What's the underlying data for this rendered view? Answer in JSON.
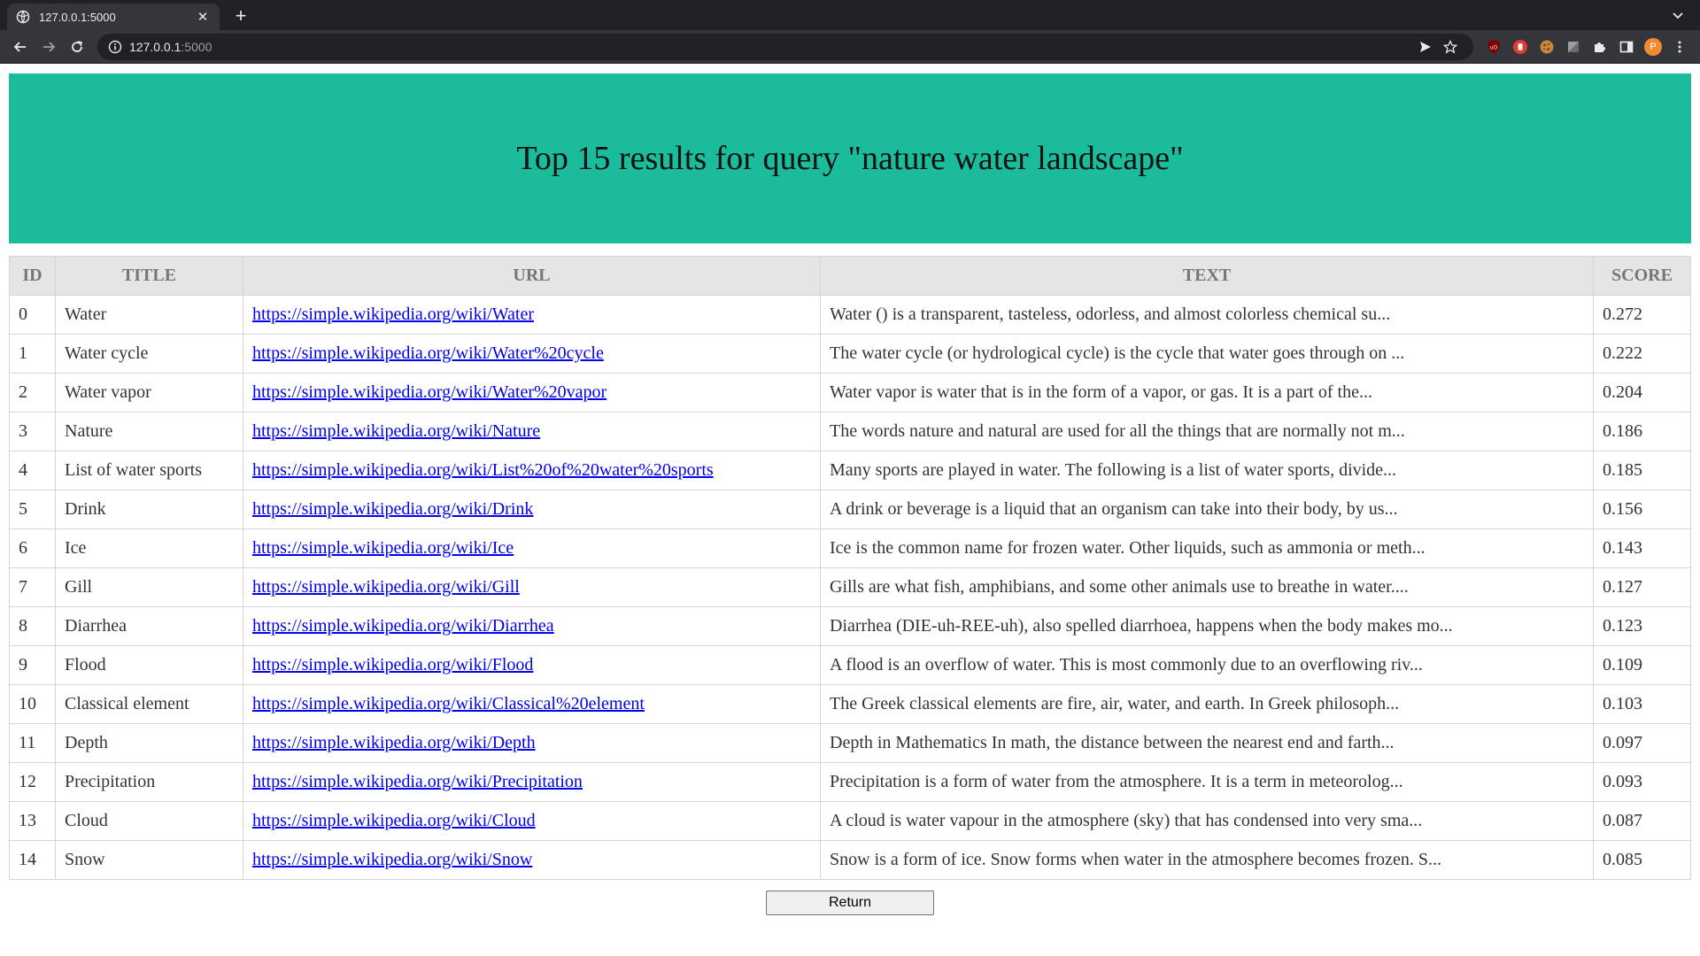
{
  "browser": {
    "tab_title": "127.0.0.1:5000",
    "url_host": "127.0.0.1",
    "url_port": ":5000",
    "profile_initial": "P"
  },
  "page": {
    "heading": "Top 15 results for query \"nature water landscape\"",
    "columns": [
      "ID",
      "TITLE",
      "URL",
      "TEXT",
      "SCORE"
    ],
    "rows": [
      {
        "id": "0",
        "title": "Water",
        "url": "https://simple.wikipedia.org/wiki/Water",
        "text": "Water () is a transparent, tasteless, odorless, and almost colorless chemical su...",
        "score": "0.272"
      },
      {
        "id": "1",
        "title": "Water cycle",
        "url": "https://simple.wikipedia.org/wiki/Water%20cycle",
        "text": "The water cycle (or hydrological cycle) is the cycle that water goes through on ...",
        "score": "0.222"
      },
      {
        "id": "2",
        "title": "Water vapor",
        "url": "https://simple.wikipedia.org/wiki/Water%20vapor",
        "text": "Water vapor is water that is in the form of a vapor, or gas. It is a part of the...",
        "score": "0.204"
      },
      {
        "id": "3",
        "title": "Nature",
        "url": "https://simple.wikipedia.org/wiki/Nature",
        "text": "The words nature and natural are used for all the things that are normally not m...",
        "score": "0.186"
      },
      {
        "id": "4",
        "title": "List of water sports",
        "url": "https://simple.wikipedia.org/wiki/List%20of%20water%20sports",
        "text": "Many sports are played in water. The following is a list of water sports, divide...",
        "score": "0.185"
      },
      {
        "id": "5",
        "title": "Drink",
        "url": "https://simple.wikipedia.org/wiki/Drink",
        "text": "A drink or beverage is a liquid that an organism can take into their body, by us...",
        "score": "0.156"
      },
      {
        "id": "6",
        "title": "Ice",
        "url": "https://simple.wikipedia.org/wiki/Ice",
        "text": "Ice is the common name for frozen water. Other liquids, such as ammonia or meth...",
        "score": "0.143"
      },
      {
        "id": "7",
        "title": "Gill",
        "url": "https://simple.wikipedia.org/wiki/Gill",
        "text": "Gills are what fish, amphibians, and some other animals use to breathe in water....",
        "score": "0.127"
      },
      {
        "id": "8",
        "title": "Diarrhea",
        "url": "https://simple.wikipedia.org/wiki/Diarrhea",
        "text": "Diarrhea (DIE-uh-REE-uh), also spelled diarrhoea, happens when the body makes mo...",
        "score": "0.123"
      },
      {
        "id": "9",
        "title": "Flood",
        "url": "https://simple.wikipedia.org/wiki/Flood",
        "text": "A flood is an overflow of water. This is most commonly due to an overflowing riv...",
        "score": "0.109"
      },
      {
        "id": "10",
        "title": "Classical element",
        "url": "https://simple.wikipedia.org/wiki/Classical%20element",
        "text": "The Greek classical elements are fire, air, water, and earth. In Greek philosoph...",
        "score": "0.103"
      },
      {
        "id": "11",
        "title": "Depth",
        "url": "https://simple.wikipedia.org/wiki/Depth",
        "text": "Depth in Mathematics In math, the distance between the nearest end and farth...",
        "score": "0.097"
      },
      {
        "id": "12",
        "title": "Precipitation",
        "url": "https://simple.wikipedia.org/wiki/Precipitation",
        "text": "Precipitation is a form of water from the atmosphere. It is a term in meteorolog...",
        "score": "0.093"
      },
      {
        "id": "13",
        "title": "Cloud",
        "url": "https://simple.wikipedia.org/wiki/Cloud",
        "text": "A cloud is water vapour in the atmosphere (sky) that has condensed into very sma...",
        "score": "0.087"
      },
      {
        "id": "14",
        "title": "Snow",
        "url": "https://simple.wikipedia.org/wiki/Snow",
        "text": "Snow is a form of ice. Snow forms when water in the atmosphere becomes frozen. S...",
        "score": "0.085"
      }
    ],
    "return_label": "Return"
  },
  "colors": {
    "banner": "#1abc9c",
    "header_bg": "#e5e5e5",
    "link": "#0000ee"
  }
}
